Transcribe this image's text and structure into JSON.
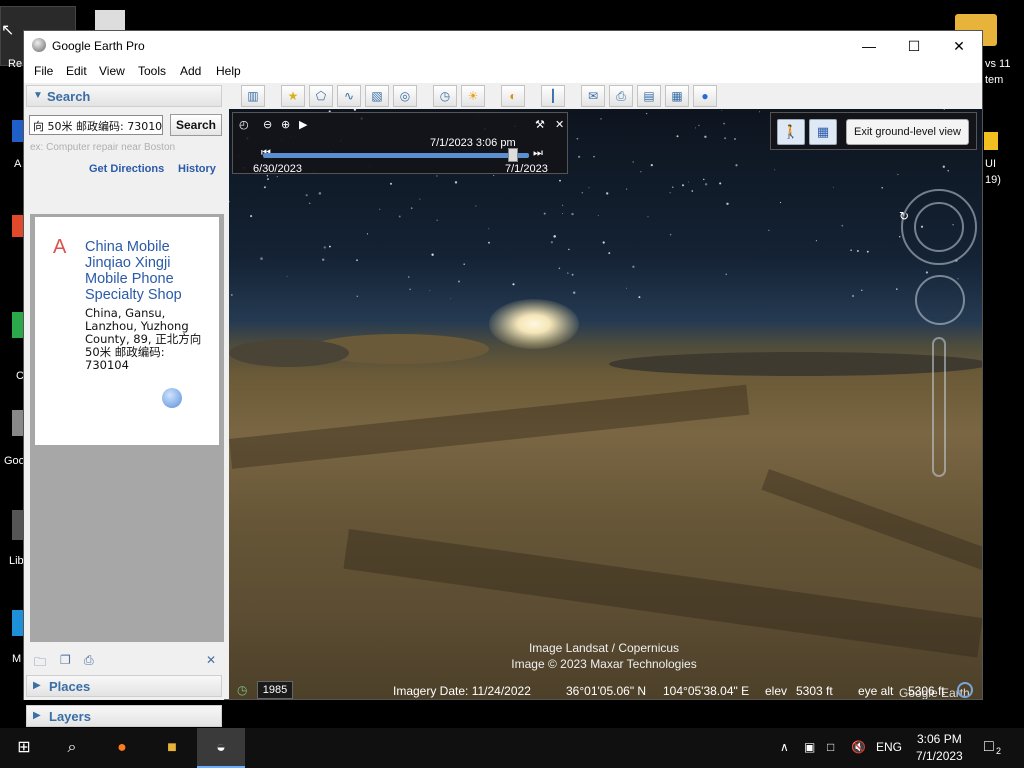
{
  "window": {
    "title": "Google Earth Pro",
    "minimize_label": "—",
    "maximize_label": "☐",
    "close_label": "✕"
  },
  "menu": [
    "File",
    "Edit",
    "View",
    "Tools",
    "Add",
    "Help"
  ],
  "search_panel": {
    "header": "Search",
    "input_value": "向 50米 邮政编码: 730104",
    "button": "Search",
    "placeholder_hint": "ex: Computer repair near Boston",
    "get_directions": "Get Directions",
    "history": "History"
  },
  "result": {
    "marker": "A",
    "name": "China Mobile Jinqiao Xingji Mobile Phone Specialty Shop",
    "address": "China, Gansu, Lanzhou, Yuzhong County, 89, 正北方向 50米 邮政编码: 730104"
  },
  "panels": {
    "places": "Places",
    "layers": "Layers"
  },
  "time_slider": {
    "current": "7/1/2023   3:06 pm",
    "start": "6/30/2023",
    "end": "7/1/2023",
    "position": 0.94
  },
  "ground_view": {
    "exit_label": "Exit ground-level view"
  },
  "credits": {
    "line1": "Image Landsat / Copernicus",
    "line2": "Image © 2023 Maxar Technologies",
    "brand": "Google Earth"
  },
  "status": {
    "year": "1985",
    "imagery_date": "Imagery Date: 11/24/2022",
    "lat": "36°01'05.06\" N",
    "lon": "104°05'38.04\" E",
    "elev_label": "elev",
    "elev": "5303 ft",
    "eye_label": "eye alt",
    "eye_alt": "5306 ft"
  },
  "desktop_icons": [
    "Re",
    "A",
    "C",
    "Goo",
    "Lib",
    "M",
    "vs 11",
    "tem",
    "UI",
    "19)"
  ],
  "taskbar": {
    "lang": "ENG",
    "time": "3:06 PM",
    "date": "7/1/2023",
    "notifications": "2"
  }
}
